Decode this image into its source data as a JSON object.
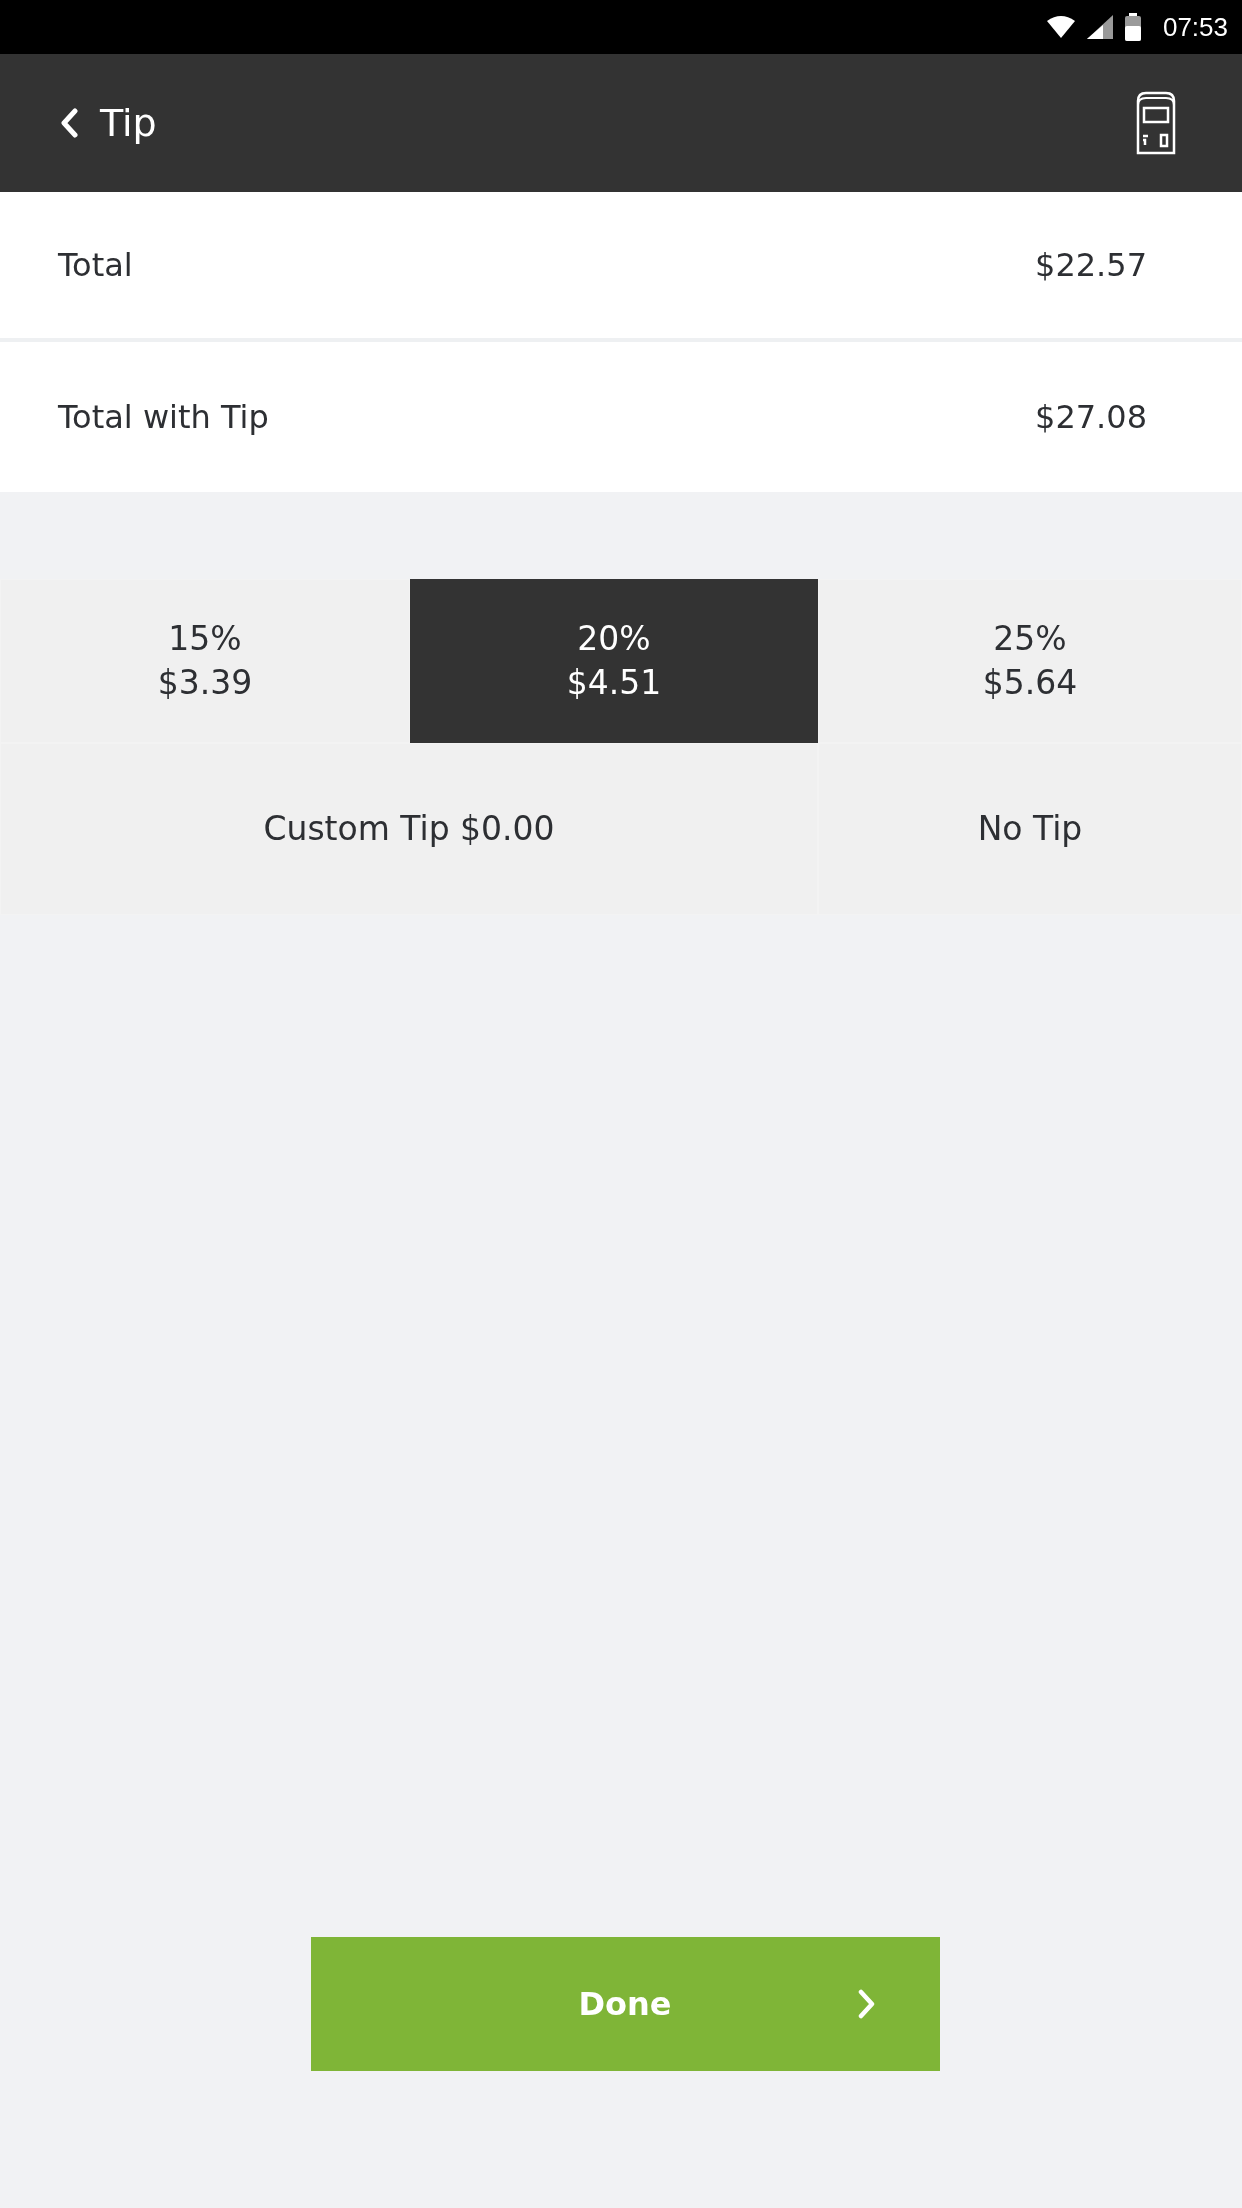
{
  "status_bar": {
    "time": "07:53"
  },
  "header": {
    "title": "Tip"
  },
  "summary": [
    {
      "label": "Total",
      "value": "$22.57"
    },
    {
      "label": "Total with Tip",
      "value": "$27.08"
    }
  ],
  "tip_options": [
    {
      "percent": "15%",
      "amount": "$3.39",
      "selected": false
    },
    {
      "percent": "20%",
      "amount": "$4.51",
      "selected": true
    },
    {
      "percent": "25%",
      "amount": "$5.64",
      "selected": false
    }
  ],
  "other_options": [
    {
      "label": "Custom Tip $0.00",
      "selected": false
    },
    {
      "label": "No Tip",
      "selected": false
    }
  ],
  "done_button": {
    "label": "Done"
  }
}
